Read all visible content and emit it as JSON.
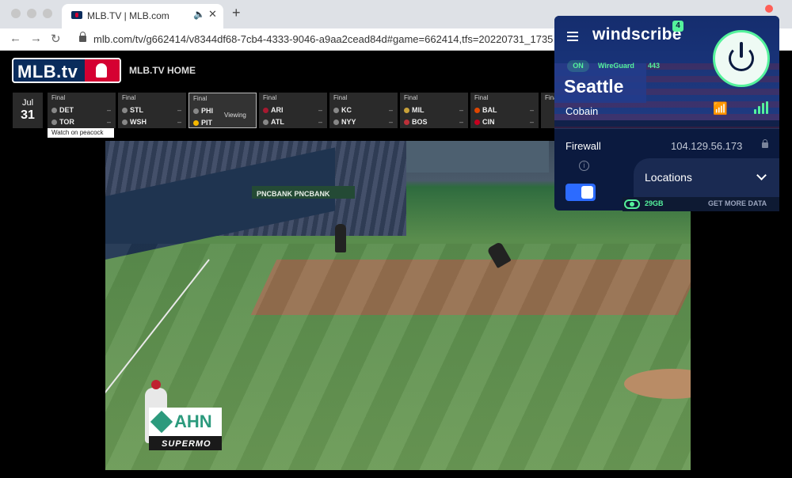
{
  "browser": {
    "tab_title": "MLB.TV | MLB.com",
    "tab_audio_icon": "speaker-icon",
    "tab_close": "✕",
    "new_tab": "+",
    "url": "mlb.com/tv/g662414/v8344df68-7cb4-4333-9046-a9aa2cead84d#game=662414,tfs=20220731_1735"
  },
  "mlb": {
    "logo_text": "MLB.tv",
    "home_link": "MLB.TV HOME",
    "date": {
      "month": "Jul",
      "day": "31"
    },
    "peacock_tip": "Watch on peacock",
    "games": [
      {
        "status": "Final",
        "away": "DET",
        "home": "TOR",
        "away_score": "–",
        "home_score": "–",
        "viewing": ""
      },
      {
        "status": "Final",
        "away": "STL",
        "home": "WSH",
        "away_score": "–",
        "home_score": "–",
        "viewing": ""
      },
      {
        "status": "Final",
        "away": "PHI",
        "home": "PIT",
        "away_score": "",
        "home_score": "",
        "viewing": "Viewing"
      },
      {
        "status": "Final",
        "away": "ARI",
        "home": "ATL",
        "away_score": "–",
        "home_score": "–",
        "viewing": ""
      },
      {
        "status": "Final",
        "away": "KC",
        "home": "NYY",
        "away_score": "–",
        "home_score": "–",
        "viewing": ""
      },
      {
        "status": "Final",
        "away": "MIL",
        "home": "BOS",
        "away_score": "–",
        "home_score": "–",
        "viewing": ""
      },
      {
        "status": "Final",
        "away": "BAL",
        "home": "CIN",
        "away_score": "–",
        "home_score": "–",
        "viewing": ""
      },
      {
        "status": "Final",
        "away": "",
        "home": "",
        "away_score": "",
        "home_score": "",
        "viewing": ""
      }
    ]
  },
  "video": {
    "banner": "PNCBANK  PNCBANK",
    "ad_brand": "AHN",
    "ad_sub": "SUPERMO"
  },
  "windscribe": {
    "brand": "windscribe",
    "badge": "4",
    "status": "ON",
    "protocol": "WireGuard",
    "port": "443",
    "city": "Seattle",
    "server": "Cobain",
    "firewall_label": "Firewall",
    "ip": "104.129.56.173",
    "info": "i",
    "locations_label": "Locations",
    "data_amount": "29GB",
    "get_more": "GET MORE DATA",
    "accent": "#55f29c"
  }
}
